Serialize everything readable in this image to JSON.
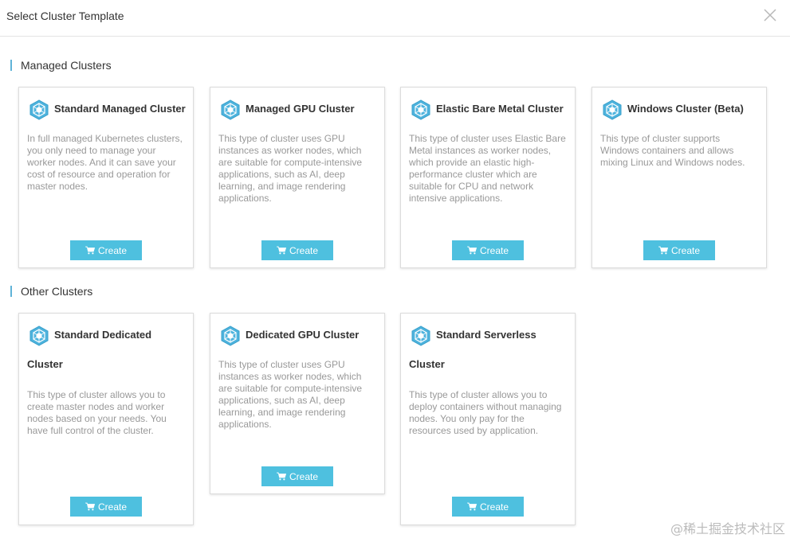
{
  "dialog": {
    "title": "Select Cluster Template"
  },
  "sections": {
    "managed": {
      "title": "Managed Clusters"
    },
    "other": {
      "title": "Other Clusters"
    }
  },
  "cards": {
    "standard_managed": {
      "name": "Standard Managed Cluster",
      "description": "In full managed Kubernetes clusters, you only need to manage your worker nodes. And it can save your cost of resource and operation for master nodes.",
      "button": "Create"
    },
    "managed_gpu": {
      "name": "Managed GPU Cluster",
      "description": "This type of cluster uses GPU instances as worker nodes, which are suitable for compute-intensive applications, such as AI, deep learning, and image rendering applications.",
      "button": "Create"
    },
    "elastic_bare_metal": {
      "name": "Elastic Bare Metal Cluster",
      "description": "This type of cluster uses Elastic Bare Metal instances as worker nodes, which provide an elastic high-performance cluster which are suitable for CPU and network intensive applications.",
      "button": "Create"
    },
    "windows": {
      "name": "Windows Cluster (Beta)",
      "description": "This type of cluster supports Windows containers and allows mixing Linux and Windows nodes.",
      "button": "Create"
    },
    "standard_dedicated": {
      "name": "Standard Dedicated",
      "name_line2": "Cluster",
      "description": "This type of cluster allows you to create master nodes and worker nodes based on your needs. You have full control of the cluster.",
      "button": "Create"
    },
    "dedicated_gpu": {
      "name": "Dedicated GPU Cluster",
      "description": "This type of cluster uses GPU instances as worker nodes, which are suitable for compute-intensive applications, such as AI, deep learning, and image rendering applications.",
      "button": "Create"
    },
    "standard_serverless": {
      "name": "Standard Serverless",
      "name_line2": "Cluster",
      "description": "This type of cluster allows you to deploy containers without managing nodes. You only pay for the resources used by application.",
      "button": "Create"
    }
  },
  "watermark": "@稀土掘金技术社区",
  "icons": {
    "cluster": "cluster-hexagon-icon",
    "cart": "cart-icon",
    "close": "close-icon"
  },
  "colors": {
    "accent": "#4ec0df",
    "section_bar": "#5fb3d8"
  }
}
